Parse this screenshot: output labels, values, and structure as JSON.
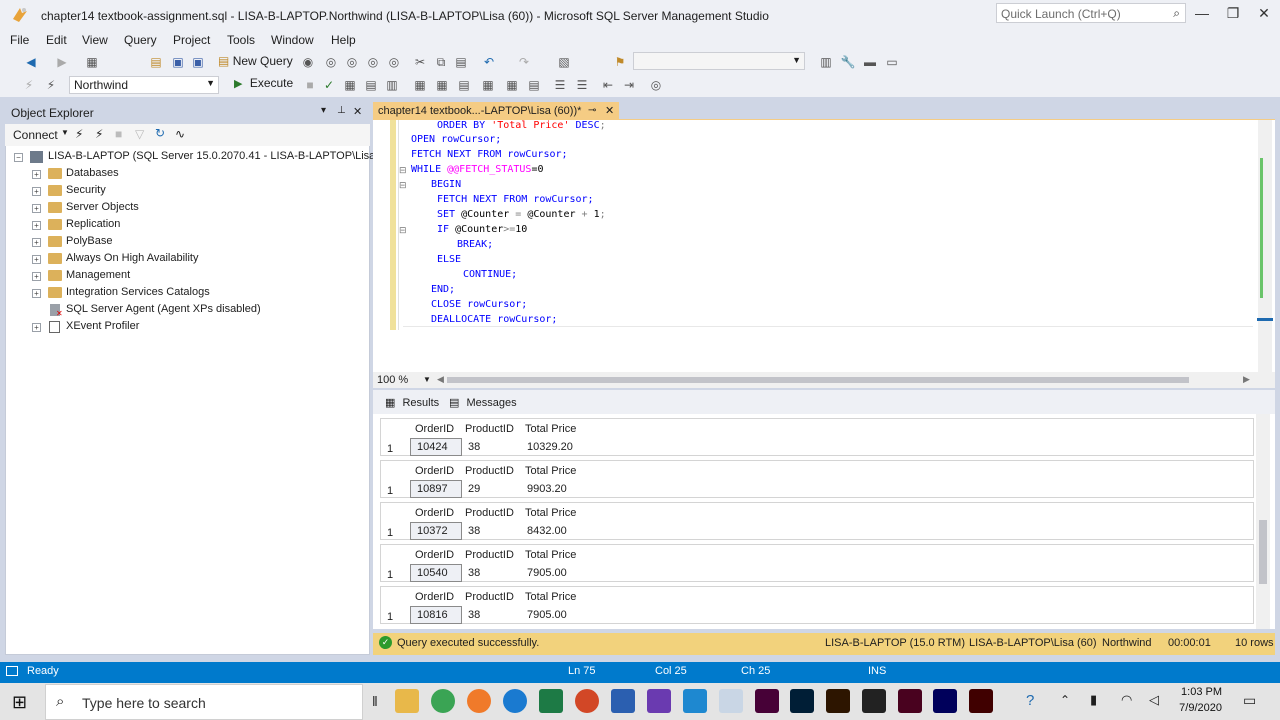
{
  "window": {
    "title": "chapter14 textbook-assignment.sql - LISA-B-LAPTOP.Northwind (LISA-B-LAPTOP\\Lisa (60)) - Microsoft SQL Server Management Studio",
    "quick_launch_placeholder": "Quick Launch (Ctrl+Q)"
  },
  "menu": [
    "File",
    "Edit",
    "View",
    "Query",
    "Project",
    "Tools",
    "Window",
    "Help"
  ],
  "toolbar": {
    "new_query": "New Query",
    "database": "Northwind",
    "execute": "Execute"
  },
  "object_explorer": {
    "title": "Object Explorer",
    "connect": "Connect",
    "server": "LISA-B-LAPTOP (SQL Server 15.0.2070.41 - LISA-B-LAPTOP\\Lisa)",
    "nodes": [
      "Databases",
      "Security",
      "Server Objects",
      "Replication",
      "PolyBase",
      "Always On High Availability",
      "Management",
      "Integration Services Catalogs"
    ],
    "agent": "SQL Server Agent (Agent XPs disabled)",
    "xevent": "XEvent Profiler"
  },
  "editor": {
    "tab": "chapter14 textbook...-LAPTOP\\Lisa (60))*",
    "zoom": "100 %",
    "lines": [
      "ORDER BY 'Total Price' DESC;",
      "OPEN rowCursor;",
      "FETCH NEXT FROM rowCursor;",
      "WHILE @@FETCH_STATUS=0",
      "BEGIN",
      "FETCH NEXT FROM rowCursor;",
      "SET @Counter = @Counter + 1;",
      "IF @Counter>=10",
      "BREAK;",
      "ELSE",
      "CONTINUE;",
      "END;",
      "CLOSE rowCursor;",
      "DEALLOCATE rowCursor;"
    ]
  },
  "results": {
    "tab_results": "Results",
    "tab_messages": "Messages",
    "columns": [
      "OrderID",
      "ProductID",
      "Total Price"
    ],
    "row_number": "1",
    "sets": [
      [
        "10424",
        "38",
        "10329.20"
      ],
      [
        "10897",
        "29",
        "9903.20"
      ],
      [
        "10372",
        "38",
        "8432.00"
      ],
      [
        "10540",
        "38",
        "7905.00"
      ],
      [
        "10816",
        "38",
        "7905.00"
      ]
    ]
  },
  "query_status": {
    "message": "Query executed successfully.",
    "server": "LISA-B-LAPTOP (15.0 RTM)",
    "user": "LISA-B-LAPTOP\\Lisa (60)",
    "db": "Northwind",
    "time": "00:00:01",
    "rows": "10 rows"
  },
  "statusbar": {
    "state": "Ready",
    "ln": "Ln 75",
    "col": "Col 25",
    "ch": "Ch 25",
    "mode": "INS"
  },
  "taskbar": {
    "search_placeholder": "Type here to search",
    "time": "1:03 PM",
    "date": "7/9/2020"
  },
  "colors": {
    "status_blue": "#007acc",
    "tab_active": "#f5cc84",
    "query_ok": "#f2d27c"
  }
}
